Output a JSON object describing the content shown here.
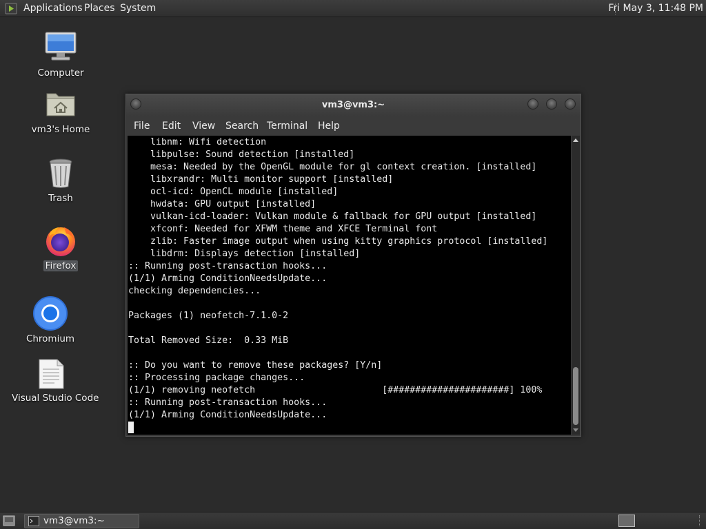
{
  "top_panel": {
    "menus": [
      "Applications",
      "Places",
      "System"
    ],
    "clock": "Fri May 3, 11:48 PM"
  },
  "desktop_icons": [
    {
      "label": "Computer",
      "icon": "computer-icon"
    },
    {
      "label": "vm3's Home",
      "icon": "home-folder-icon"
    },
    {
      "label": "Trash",
      "icon": "trash-icon"
    },
    {
      "label": "Firefox",
      "icon": "firefox-icon",
      "selected": true
    },
    {
      "label": "Chromium",
      "icon": "chromium-icon"
    },
    {
      "label": "Visual Studio Code",
      "icon": "document-icon"
    }
  ],
  "window": {
    "title": "vm3@vm3:~",
    "menu": [
      "File",
      "Edit",
      "View",
      "Search",
      "Terminal",
      "Help"
    ],
    "lines": [
      "    libnm: Wifi detection",
      "    libpulse: Sound detection [installed]",
      "    mesa: Needed by the OpenGL module for gl context creation. [installed]",
      "    libxrandr: Multi monitor support [installed]",
      "    ocl-icd: OpenCL module [installed]",
      "    hwdata: GPU output [installed]",
      "    vulkan-icd-loader: Vulkan module & fallback for GPU output [installed]",
      "    xfconf: Needed for XFWM theme and XFCE Terminal font",
      "    zlib: Faster image output when using kitty graphics protocol [installed]",
      "    libdrm: Displays detection [installed]",
      ":: Running post-transaction hooks...",
      "(1/1) Arming ConditionNeedsUpdate...",
      "checking dependencies...",
      "",
      "Packages (1) neofetch-7.1.0-2",
      "",
      "Total Removed Size:  0.33 MiB",
      "",
      ":: Do you want to remove these packages? [Y/n]",
      ":: Processing package changes...",
      "(1/1) removing neofetch                       [######################] 100%",
      ":: Running post-transaction hooks...",
      "(1/1) Arming ConditionNeedsUpdate..."
    ]
  },
  "taskbar": {
    "tasks": [
      {
        "label": "vm3@vm3:~",
        "icon": "terminal-icon"
      }
    ]
  },
  "colors": {
    "desktop_bg": "#2b2b2b",
    "terminal_bg": "#000000",
    "terminal_fg": "#e8e8e8"
  }
}
